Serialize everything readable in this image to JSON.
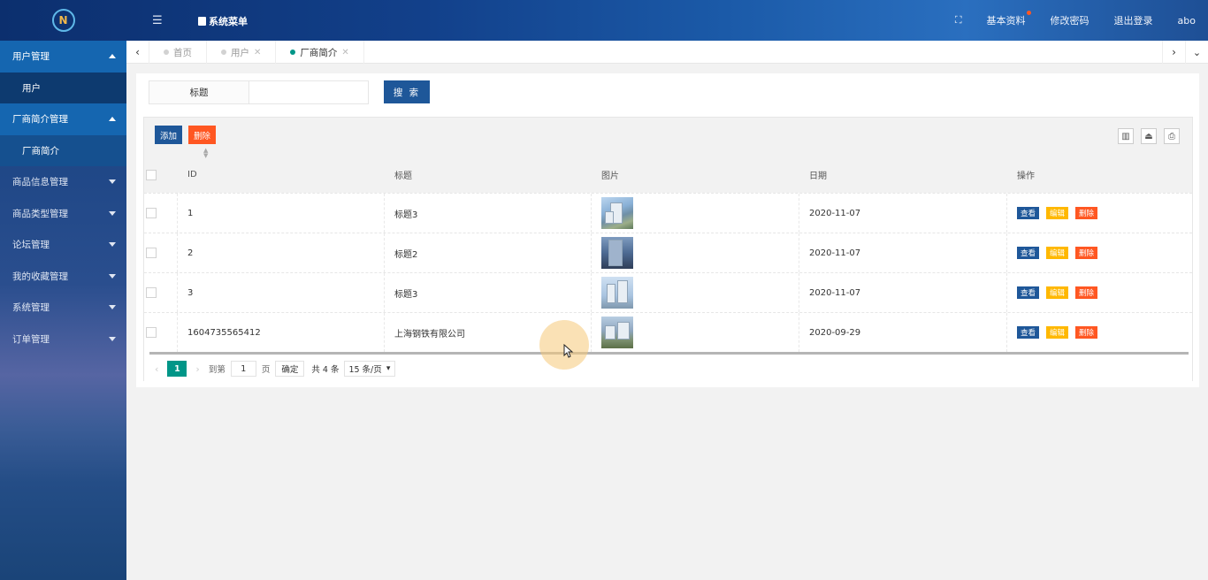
{
  "header": {
    "menu_toggle_icon": "list-icon",
    "system_menu": "系统菜单",
    "fullscreen_icon": "expand-icon",
    "profile": "基本资料",
    "change_password": "修改密码",
    "logout": "退出登录",
    "username": "abo",
    "notify_dot_color": "#ff5722"
  },
  "sidebar": {
    "groups": [
      {
        "label": "用户管理",
        "open": true,
        "children": [
          "用户"
        ]
      },
      {
        "label": "厂商简介管理",
        "open": true,
        "children": [
          "厂商简介"
        ]
      },
      {
        "label": "商品信息管理",
        "open": false
      },
      {
        "label": "商品类型管理",
        "open": false
      },
      {
        "label": "论坛管理",
        "open": false
      },
      {
        "label": "我的收藏管理",
        "open": false
      },
      {
        "label": "系统管理",
        "open": false
      },
      {
        "label": "订单管理",
        "open": false
      }
    ]
  },
  "tabs": [
    {
      "label": "首页",
      "active": false,
      "closable": false
    },
    {
      "label": "用户",
      "active": false,
      "closable": true
    },
    {
      "label": "厂商简介",
      "active": true,
      "closable": true
    }
  ],
  "search": {
    "label": "标题",
    "value": "",
    "button": "搜 索"
  },
  "toolbar": {
    "add": "添加",
    "delete": "删除"
  },
  "table": {
    "columns": [
      "ID",
      "标题",
      "图片",
      "日期",
      "操作"
    ],
    "rows": [
      {
        "id": "1",
        "title": "标题3",
        "date": "2020-11-07"
      },
      {
        "id": "2",
        "title": "标题2",
        "date": "2020-11-07"
      },
      {
        "id": "3",
        "title": "标题3",
        "date": "2020-11-07"
      },
      {
        "id": "1604735565412",
        "title": "上海钢铁有限公司",
        "date": "2020-09-29"
      }
    ],
    "actions": {
      "view": "查看",
      "edit": "编辑",
      "delete": "删除"
    }
  },
  "pager": {
    "current": "1",
    "goto_label": "到第",
    "goto_value": "1",
    "page_unit": "页",
    "confirm": "确定",
    "total": "共 4 条",
    "page_size": "15 条/页"
  },
  "colors": {
    "primary": "#1e5799",
    "danger": "#ff5722",
    "warning": "#ffb800",
    "teal": "#009688"
  }
}
